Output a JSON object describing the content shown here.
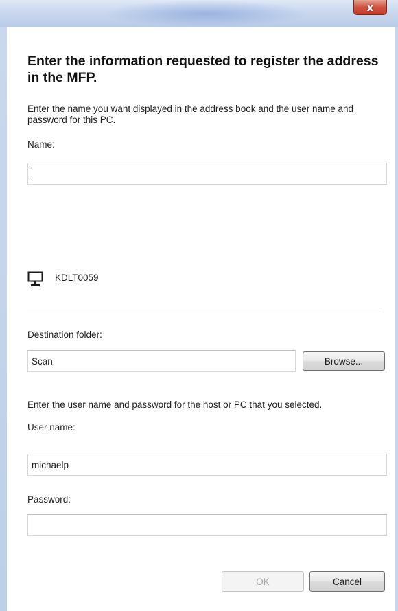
{
  "window": {
    "close_glyph": "x"
  },
  "heading": "Enter the information requested to register the address in the MFP.",
  "intro_text": "Enter the name you want displayed in the address book and the user name and password for this PC.",
  "name_field": {
    "label": "Name:",
    "value": ""
  },
  "host": {
    "icon": "computer-monitor-icon",
    "name": "KDLT0059"
  },
  "destination": {
    "label": "Destination folder:",
    "value": "Scan",
    "browse_label": "Browse..."
  },
  "credentials_text": "Enter the user name and password for the host or PC that you selected.",
  "username_field": {
    "label": "User name:",
    "value": "michaelp"
  },
  "password_field": {
    "label": "Password:",
    "value": ""
  },
  "buttons": {
    "ok_label": "OK",
    "ok_enabled": false,
    "cancel_label": "Cancel"
  }
}
